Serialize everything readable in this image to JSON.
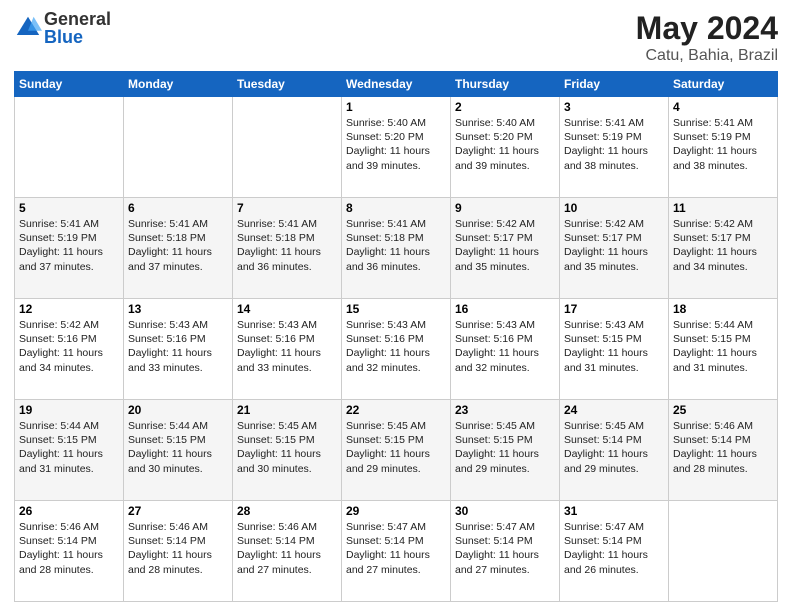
{
  "header": {
    "logo": {
      "general": "General",
      "blue": "Blue"
    },
    "title": "May 2024",
    "location": "Catu, Bahia, Brazil"
  },
  "days_of_week": [
    "Sunday",
    "Monday",
    "Tuesday",
    "Wednesday",
    "Thursday",
    "Friday",
    "Saturday"
  ],
  "weeks": [
    [
      {
        "day": "",
        "info": ""
      },
      {
        "day": "",
        "info": ""
      },
      {
        "day": "",
        "info": ""
      },
      {
        "day": "1",
        "info": "Sunrise: 5:40 AM\nSunset: 5:20 PM\nDaylight: 11 hours and 39 minutes."
      },
      {
        "day": "2",
        "info": "Sunrise: 5:40 AM\nSunset: 5:20 PM\nDaylight: 11 hours and 39 minutes."
      },
      {
        "day": "3",
        "info": "Sunrise: 5:41 AM\nSunset: 5:19 PM\nDaylight: 11 hours and 38 minutes."
      },
      {
        "day": "4",
        "info": "Sunrise: 5:41 AM\nSunset: 5:19 PM\nDaylight: 11 hours and 38 minutes."
      }
    ],
    [
      {
        "day": "5",
        "info": "Sunrise: 5:41 AM\nSunset: 5:19 PM\nDaylight: 11 hours and 37 minutes."
      },
      {
        "day": "6",
        "info": "Sunrise: 5:41 AM\nSunset: 5:18 PM\nDaylight: 11 hours and 37 minutes."
      },
      {
        "day": "7",
        "info": "Sunrise: 5:41 AM\nSunset: 5:18 PM\nDaylight: 11 hours and 36 minutes."
      },
      {
        "day": "8",
        "info": "Sunrise: 5:41 AM\nSunset: 5:18 PM\nDaylight: 11 hours and 36 minutes."
      },
      {
        "day": "9",
        "info": "Sunrise: 5:42 AM\nSunset: 5:17 PM\nDaylight: 11 hours and 35 minutes."
      },
      {
        "day": "10",
        "info": "Sunrise: 5:42 AM\nSunset: 5:17 PM\nDaylight: 11 hours and 35 minutes."
      },
      {
        "day": "11",
        "info": "Sunrise: 5:42 AM\nSunset: 5:17 PM\nDaylight: 11 hours and 34 minutes."
      }
    ],
    [
      {
        "day": "12",
        "info": "Sunrise: 5:42 AM\nSunset: 5:16 PM\nDaylight: 11 hours and 34 minutes."
      },
      {
        "day": "13",
        "info": "Sunrise: 5:43 AM\nSunset: 5:16 PM\nDaylight: 11 hours and 33 minutes."
      },
      {
        "day": "14",
        "info": "Sunrise: 5:43 AM\nSunset: 5:16 PM\nDaylight: 11 hours and 33 minutes."
      },
      {
        "day": "15",
        "info": "Sunrise: 5:43 AM\nSunset: 5:16 PM\nDaylight: 11 hours and 32 minutes."
      },
      {
        "day": "16",
        "info": "Sunrise: 5:43 AM\nSunset: 5:16 PM\nDaylight: 11 hours and 32 minutes."
      },
      {
        "day": "17",
        "info": "Sunrise: 5:43 AM\nSunset: 5:15 PM\nDaylight: 11 hours and 31 minutes."
      },
      {
        "day": "18",
        "info": "Sunrise: 5:44 AM\nSunset: 5:15 PM\nDaylight: 11 hours and 31 minutes."
      }
    ],
    [
      {
        "day": "19",
        "info": "Sunrise: 5:44 AM\nSunset: 5:15 PM\nDaylight: 11 hours and 31 minutes."
      },
      {
        "day": "20",
        "info": "Sunrise: 5:44 AM\nSunset: 5:15 PM\nDaylight: 11 hours and 30 minutes."
      },
      {
        "day": "21",
        "info": "Sunrise: 5:45 AM\nSunset: 5:15 PM\nDaylight: 11 hours and 30 minutes."
      },
      {
        "day": "22",
        "info": "Sunrise: 5:45 AM\nSunset: 5:15 PM\nDaylight: 11 hours and 29 minutes."
      },
      {
        "day": "23",
        "info": "Sunrise: 5:45 AM\nSunset: 5:15 PM\nDaylight: 11 hours and 29 minutes."
      },
      {
        "day": "24",
        "info": "Sunrise: 5:45 AM\nSunset: 5:14 PM\nDaylight: 11 hours and 29 minutes."
      },
      {
        "day": "25",
        "info": "Sunrise: 5:46 AM\nSunset: 5:14 PM\nDaylight: 11 hours and 28 minutes."
      }
    ],
    [
      {
        "day": "26",
        "info": "Sunrise: 5:46 AM\nSunset: 5:14 PM\nDaylight: 11 hours and 28 minutes."
      },
      {
        "day": "27",
        "info": "Sunrise: 5:46 AM\nSunset: 5:14 PM\nDaylight: 11 hours and 28 minutes."
      },
      {
        "day": "28",
        "info": "Sunrise: 5:46 AM\nSunset: 5:14 PM\nDaylight: 11 hours and 27 minutes."
      },
      {
        "day": "29",
        "info": "Sunrise: 5:47 AM\nSunset: 5:14 PM\nDaylight: 11 hours and 27 minutes."
      },
      {
        "day": "30",
        "info": "Sunrise: 5:47 AM\nSunset: 5:14 PM\nDaylight: 11 hours and 27 minutes."
      },
      {
        "day": "31",
        "info": "Sunrise: 5:47 AM\nSunset: 5:14 PM\nDaylight: 11 hours and 26 minutes."
      },
      {
        "day": "",
        "info": ""
      }
    ]
  ]
}
